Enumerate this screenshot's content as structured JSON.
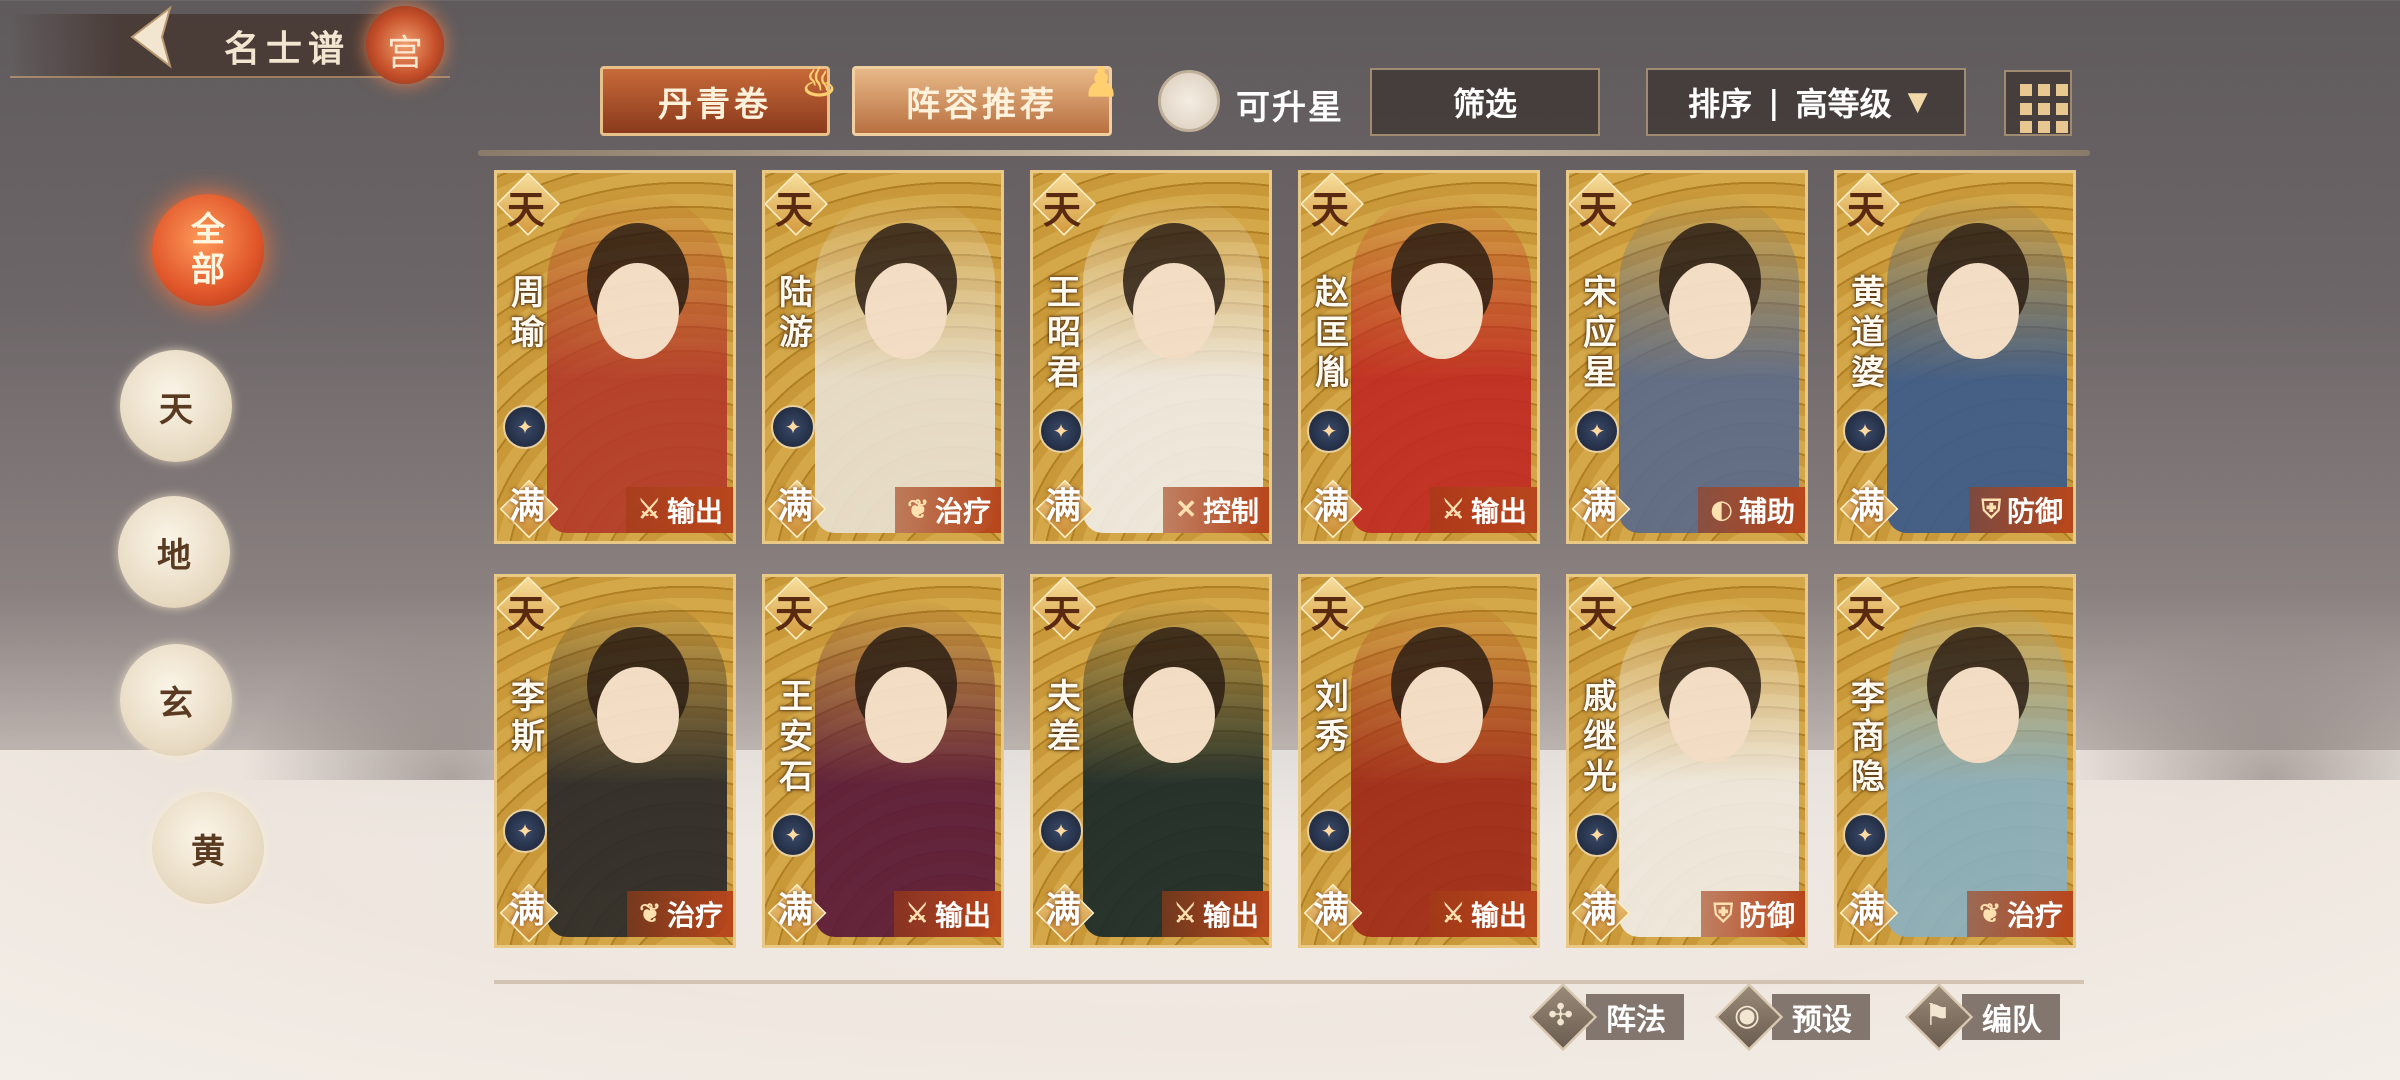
{
  "header": {
    "title": "名士谱",
    "emblem": "宫"
  },
  "tabs": [
    {
      "label": "丹青卷"
    },
    {
      "label": "阵容推荐"
    }
  ],
  "toolbar": {
    "upstar_label": "可升星",
    "filter_label": "筛选",
    "sort_label": "排序",
    "sort_sep": "|",
    "sort_value": "高等级"
  },
  "rank_filters": [
    {
      "label": "全部",
      "line1": "全",
      "line2": "部",
      "active": true
    },
    {
      "label": "天"
    },
    {
      "label": "地"
    },
    {
      "label": "玄"
    },
    {
      "label": "黄"
    }
  ],
  "heroes": [
    {
      "tier": "天",
      "name": "周瑜",
      "full": "满",
      "role": "输出",
      "role_icon": "sword-icon"
    },
    {
      "tier": "天",
      "name": "陆游",
      "full": "满",
      "role": "治疗",
      "role_icon": "sprout-icon"
    },
    {
      "tier": "天",
      "name": "王昭君",
      "full": "满",
      "role": "控制",
      "role_icon": "cross-icon"
    },
    {
      "tier": "天",
      "name": "赵匡胤",
      "full": "满",
      "role": "输出",
      "role_icon": "sword-icon"
    },
    {
      "tier": "天",
      "name": "宋应星",
      "full": "满",
      "role": "辅助",
      "role_icon": "orb-icon"
    },
    {
      "tier": "天",
      "name": "黄道婆",
      "full": "满",
      "role": "防御",
      "role_icon": "shield-icon"
    },
    {
      "tier": "天",
      "name": "李斯",
      "full": "满",
      "role": "治疗",
      "role_icon": "sprout-icon"
    },
    {
      "tier": "天",
      "name": "王安石",
      "full": "满",
      "role": "输出",
      "role_icon": "sword-icon"
    },
    {
      "tier": "天",
      "name": "夫差",
      "full": "满",
      "role": "输出",
      "role_icon": "sword-icon"
    },
    {
      "tier": "天",
      "name": "刘秀",
      "full": "满",
      "role": "输出",
      "role_icon": "sword-icon"
    },
    {
      "tier": "天",
      "name": "戚继光",
      "full": "满",
      "role": "防御",
      "role_icon": "shield-icon"
    },
    {
      "tier": "天",
      "name": "李商隐",
      "full": "满",
      "role": "治疗",
      "role_icon": "sprout-icon"
    }
  ],
  "actions": [
    {
      "label": "阵法",
      "icon": "formation-icon"
    },
    {
      "label": "预设",
      "icon": "eye-icon"
    },
    {
      "label": "编队",
      "icon": "flag-icon"
    }
  ],
  "colors": {
    "accent_orange": "#e0562a",
    "card_gold": "#c99838",
    "role_red": "#b8461c"
  }
}
